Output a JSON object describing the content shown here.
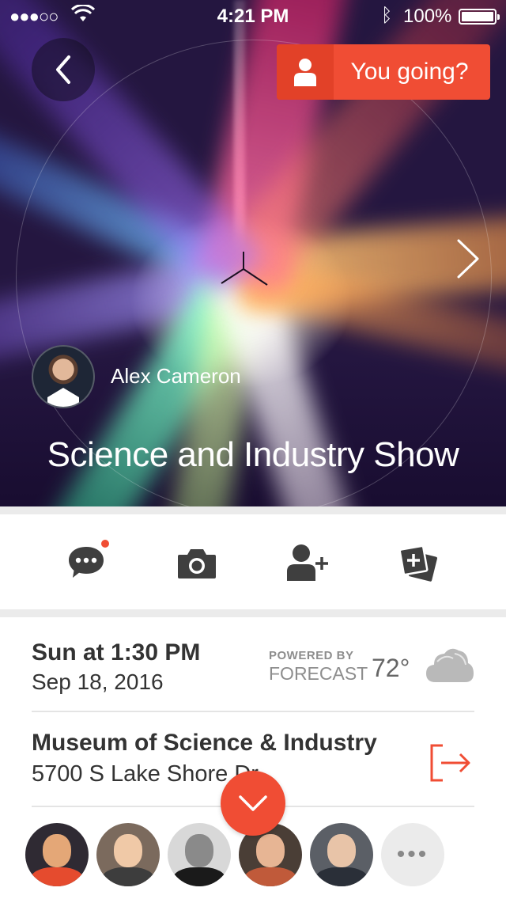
{
  "status_bar": {
    "carrier_signal": "●●●○○",
    "time": "4:21 PM",
    "battery_pct": "100%",
    "battery_level": 1.0
  },
  "header": {
    "back_icon": "chevron-left-icon",
    "rsvp_label": "You going?",
    "rsvp_icon": "person-icon",
    "next_icon": "chevron-right-icon",
    "host_name": "Alex Cameron",
    "event_title": "Science and Industry Show"
  },
  "actions": [
    {
      "name": "comments",
      "icon": "chat-bubble-icon",
      "has_notification": true
    },
    {
      "name": "photo",
      "icon": "camera-icon"
    },
    {
      "name": "invite",
      "icon": "add-person-icon"
    },
    {
      "name": "add-to-calendar",
      "icon": "add-card-icon"
    }
  ],
  "schedule": {
    "when_primary": "Sun at 1:30 PM",
    "when_secondary": "Sep 18, 2016"
  },
  "weather": {
    "powered_by": "POWERED BY",
    "provider": "FORECAST",
    "temperature": "72°",
    "condition_icon": "cloud-icon"
  },
  "location": {
    "venue": "Museum of Science & Industry",
    "address": "5700 S Lake Shore Dr",
    "directions_icon": "directions-icon"
  },
  "attendees": {
    "count_visible": 5,
    "more_label": "•••"
  },
  "colors": {
    "accent": "#f04d34",
    "icon_gray": "#3f3f3f",
    "text_dark": "#333333",
    "text_muted": "#8d8d8d",
    "divider": "#ebebeb"
  }
}
